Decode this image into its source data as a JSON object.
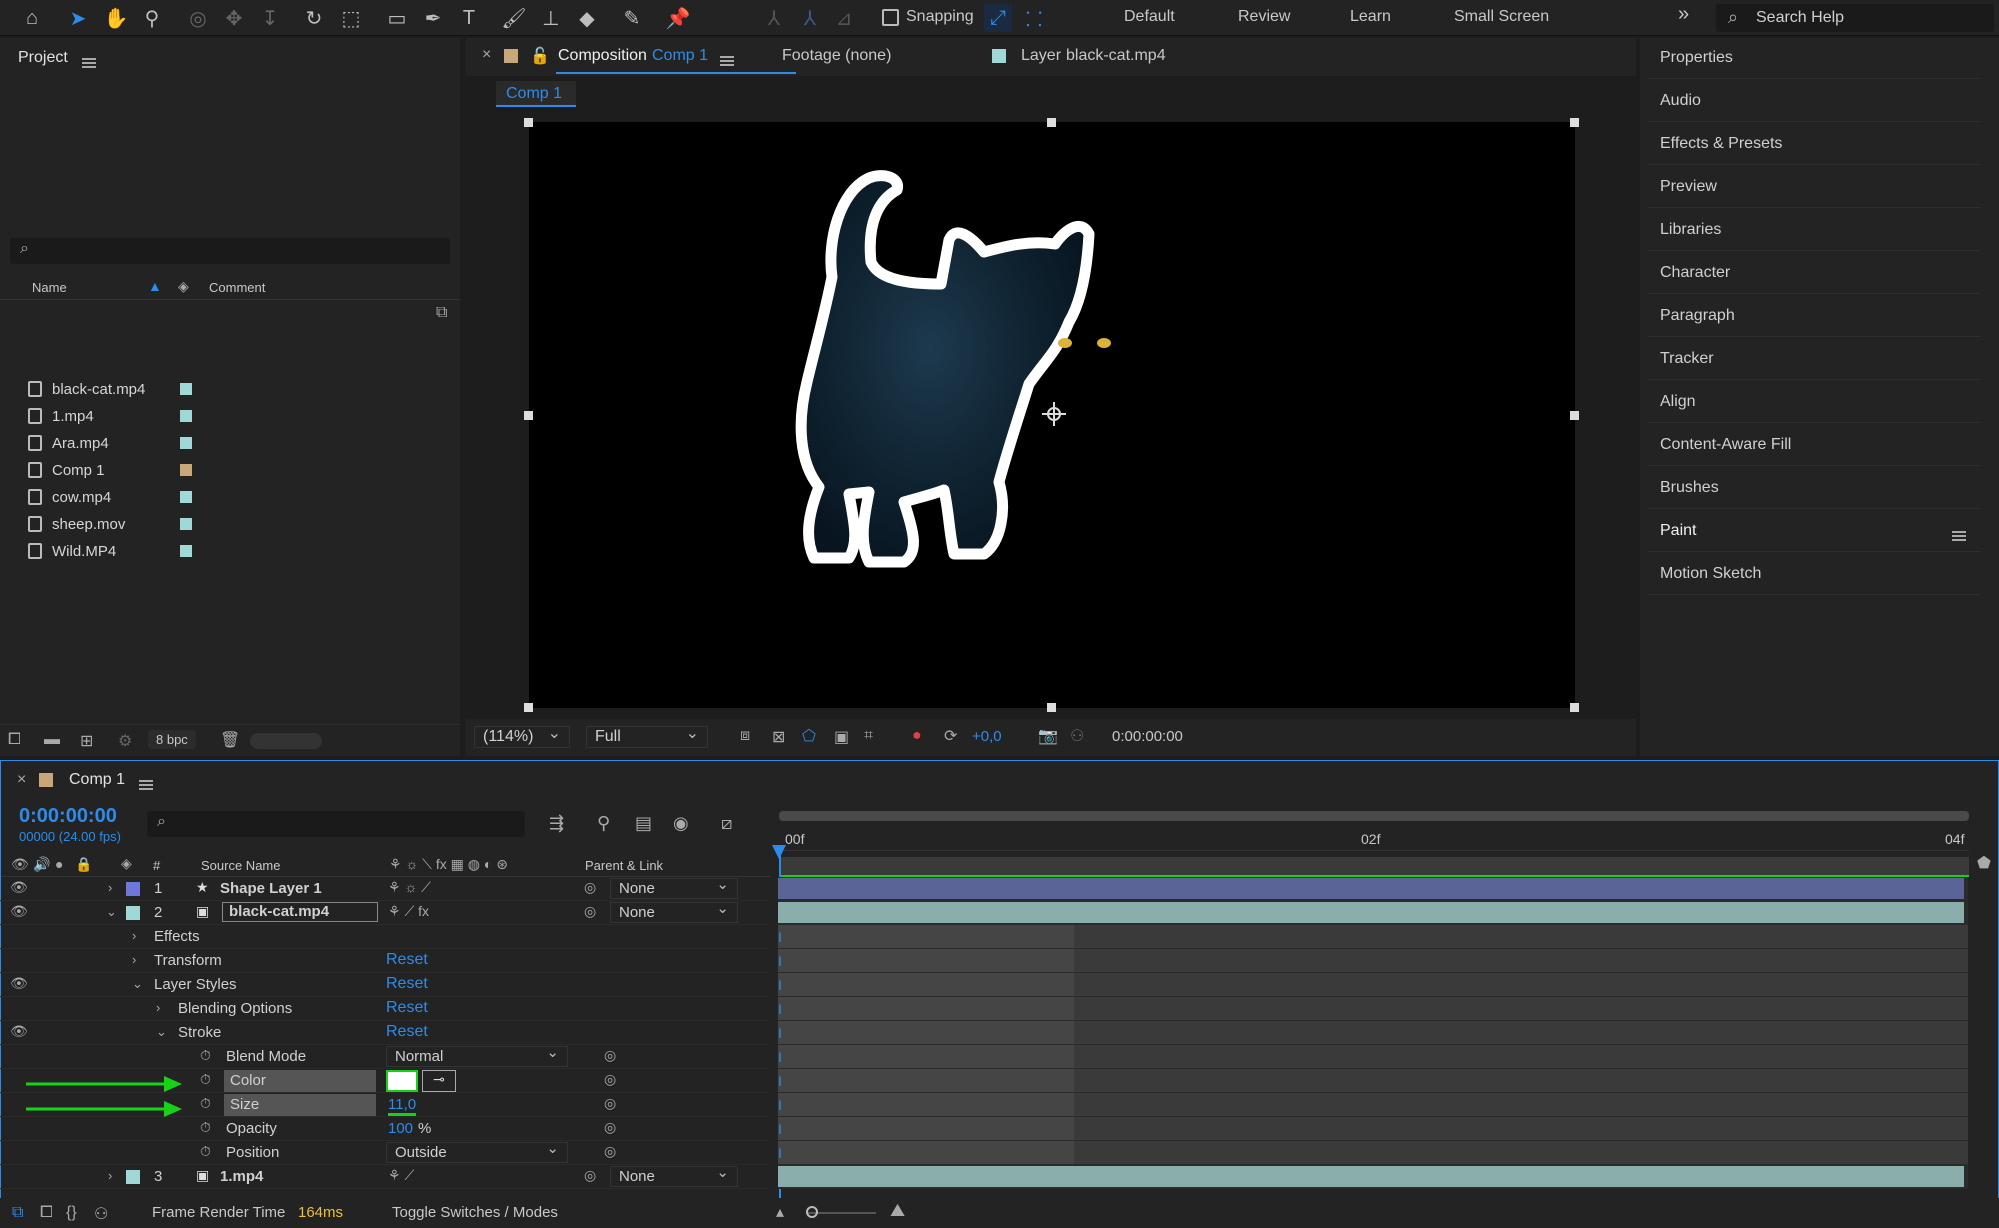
{
  "toolbar": {
    "snapping_label": "Snapping",
    "workspaces": [
      "Default",
      "Review",
      "Learn",
      "Small Screen"
    ],
    "more": "»",
    "search_placeholder": "Search Help"
  },
  "project": {
    "title": "Project",
    "col_name": "Name",
    "col_comment": "Comment",
    "items": [
      {
        "name": "black-cat.mp4",
        "label_color": "#9fd8d6"
      },
      {
        "name": "1.mp4",
        "label_color": "#9fd8d6"
      },
      {
        "name": "Ara.mp4",
        "label_color": "#9fd8d6"
      },
      {
        "name": "Comp 1",
        "label_color": "#c8a878"
      },
      {
        "name": "cow.mp4",
        "label_color": "#9fd8d6"
      },
      {
        "name": "sheep.mov",
        "label_color": "#9fd8d6"
      },
      {
        "name": "Wild.MP4",
        "label_color": "#9fd8d6"
      }
    ],
    "bpc": "8 bpc"
  },
  "comp_panel": {
    "tab_prefix": "Composition",
    "tab_comp": "Comp 1",
    "footage_tab": "Footage (none)",
    "layer_tab_prefix": "Layer",
    "layer_tab_name": "black-cat.mp4",
    "subtab": "Comp 1",
    "zoom": "(114%)",
    "resolution": "Full",
    "exposure": "+0,0",
    "timecode": "0:00:00:00"
  },
  "right_panel": {
    "items": [
      "Properties",
      "Audio",
      "Effects & Presets",
      "Preview",
      "Libraries",
      "Character",
      "Paragraph",
      "Tracker",
      "Align",
      "Content-Aware Fill",
      "Brushes",
      "Paint",
      "Motion Sketch"
    ]
  },
  "timeline": {
    "tab": "Comp 1",
    "timecode": "0:00:00:00",
    "frames_fps": "00000 (24.00 fps)",
    "col_hash": "#",
    "col_source": "Source Name",
    "col_parent": "Parent & Link",
    "ruler": [
      "00f",
      "02f",
      "04f"
    ],
    "layers": [
      {
        "num": "1",
        "name": "Shape Layer 1",
        "parent": "None",
        "color": "#6d78d8"
      },
      {
        "num": "2",
        "name": "black-cat.mp4",
        "parent": "None",
        "color": "#9fd8d6"
      },
      {
        "num": "3",
        "name": "1.mp4",
        "parent": "None",
        "color": "#9fd8d6"
      }
    ],
    "props": {
      "effects": "Effects",
      "transform": "Transform",
      "layer_styles": "Layer Styles",
      "blending_options": "Blending Options",
      "stroke": "Stroke",
      "blend_mode": "Blend Mode",
      "blend_mode_value": "Normal",
      "color": "Color",
      "size": "Size",
      "size_value": "11,0",
      "opacity": "Opacity",
      "opacity_value": "100",
      "opacity_unit": "%",
      "position": "Position",
      "position_value": "Outside",
      "reset": "Reset"
    },
    "footer_label": "Frame Render Time",
    "footer_value": "164ms",
    "toggle": "Toggle Switches / Modes"
  },
  "colors": {
    "accent": "#2d8ceb",
    "stroke_color": "#ffffff",
    "arrow": "#17d317"
  }
}
